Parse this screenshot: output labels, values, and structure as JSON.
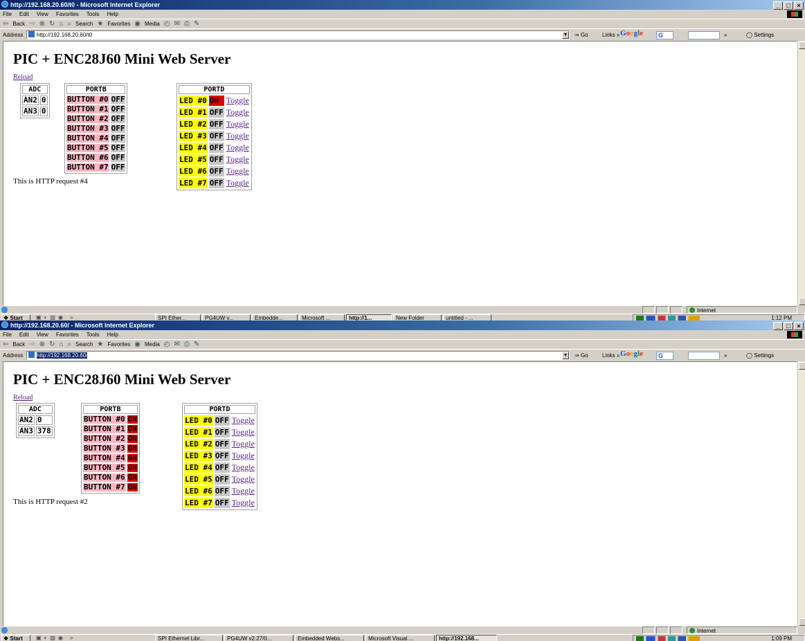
{
  "screens": [
    {
      "window_title": "http://192.168.20.60/t0 - Microsoft Internet Explorer",
      "address_label": "Address",
      "address_url": "http://192.168.20.60/t0",
      "page": {
        "title": "PIC + ENC28J60 Mini Web Server",
        "reload_link": "Reload",
        "adc": {
          "header": "ADC",
          "rows": [
            {
              "name": "AN2",
              "value": "0"
            },
            {
              "name": "AN3",
              "value": "0"
            }
          ]
        },
        "portb": {
          "header": "PORTB",
          "rows": [
            {
              "name": "BUTTON #0",
              "state": "OFF"
            },
            {
              "name": "BUTTON #1",
              "state": "OFF"
            },
            {
              "name": "BUTTON #2",
              "state": "OFF"
            },
            {
              "name": "BUTTON #3",
              "state": "OFF"
            },
            {
              "name": "BUTTON #4",
              "state": "OFF"
            },
            {
              "name": "BUTTON #5",
              "state": "OFF"
            },
            {
              "name": "BUTTON #6",
              "state": "OFF"
            },
            {
              "name": "BUTTON #7",
              "state": "OFF"
            }
          ]
        },
        "portd": {
          "header": "PORTD",
          "rows": [
            {
              "name": "LED #0",
              "state": "ON",
              "action": "Toggle"
            },
            {
              "name": "LED #1",
              "state": "OFF",
              "action": "Toggle"
            },
            {
              "name": "LED #2",
              "state": "OFF",
              "action": "Toggle"
            },
            {
              "name": "LED #3",
              "state": "OFF",
              "action": "Toggle"
            },
            {
              "name": "LED #4",
              "state": "OFF",
              "action": "Toggle"
            },
            {
              "name": "LED #5",
              "state": "OFF",
              "action": "Toggle"
            },
            {
              "name": "LED #6",
              "state": "OFF",
              "action": "Toggle"
            },
            {
              "name": "LED #7",
              "state": "OFF",
              "action": "Toggle"
            }
          ]
        },
        "request_text": "This is HTTP request #4"
      },
      "taskbar": {
        "start_label": "Start",
        "tasks": [
          "SPI Ether...",
          "PG4UW v...",
          "Embedde...",
          "Microsoft ...",
          "http://1...",
          "New Folder",
          "untitled - ..."
        ],
        "active_task": 4,
        "clock": "1:12 PM"
      }
    },
    {
      "window_title": "http://192.168.20.60/ - Microsoft Internet Explorer",
      "address_label": "Address",
      "address_url": "http://192.168.20.60/",
      "page": {
        "title": "PIC + ENC28J60 Mini Web Server",
        "reload_link": "Reload",
        "adc": {
          "header": "ADC",
          "rows": [
            {
              "name": "AN2",
              "value": "0"
            },
            {
              "name": "AN3",
              "value": "378"
            }
          ]
        },
        "portb": {
          "header": "PORTB",
          "rows": [
            {
              "name": "BUTTON #0",
              "state": "ON"
            },
            {
              "name": "BUTTON #1",
              "state": "ON"
            },
            {
              "name": "BUTTON #2",
              "state": "ON"
            },
            {
              "name": "BUTTON #3",
              "state": "ON"
            },
            {
              "name": "BUTTON #4",
              "state": "ON"
            },
            {
              "name": "BUTTON #5",
              "state": "ON"
            },
            {
              "name": "BUTTON #6",
              "state": "ON"
            },
            {
              "name": "BUTTON #7",
              "state": "ON"
            }
          ]
        },
        "portd": {
          "header": "PORTD",
          "rows": [
            {
              "name": "LED #0",
              "state": "OFF",
              "action": "Toggle"
            },
            {
              "name": "LED #1",
              "state": "OFF",
              "action": "Toggle"
            },
            {
              "name": "LED #2",
              "state": "OFF",
              "action": "Toggle"
            },
            {
              "name": "LED #3",
              "state": "OFF",
              "action": "Toggle"
            },
            {
              "name": "LED #4",
              "state": "OFF",
              "action": "Toggle"
            },
            {
              "name": "LED #5",
              "state": "OFF",
              "action": "Toggle"
            },
            {
              "name": "LED #6",
              "state": "OFF",
              "action": "Toggle"
            },
            {
              "name": "LED #7",
              "state": "OFF",
              "action": "Toggle"
            }
          ]
        },
        "request_text": "This is HTTP request #2"
      },
      "taskbar": {
        "start_label": "Start",
        "tasks": [
          "SPI Ethernet Libr...",
          "PG4UW v2.27/0...",
          "Embedded Webs...",
          "Microsoft Visual ...",
          "http://192.168..."
        ],
        "active_task": 4,
        "clock": "1:09 PM"
      }
    }
  ],
  "browser": {
    "menu": [
      "File",
      "Edit",
      "View",
      "Favorites",
      "Tools",
      "Help"
    ],
    "toolbar": {
      "back": "Back",
      "search": "Search",
      "favorites": "Favorites",
      "media": "Media"
    },
    "go_label": "Go",
    "links_label": "Links",
    "google_letters": [
      "G",
      "o",
      "o",
      "g",
      "l",
      "e"
    ],
    "google_field": "G",
    "settings_label": "Settings",
    "status_zone": "Internet"
  },
  "colors": {
    "button_bg": "#ffb6c1",
    "led_bg": "#ffff00",
    "on_bg": "#e00000",
    "off_bg": "#c8c8c8",
    "titlebar": "#0a246a"
  }
}
